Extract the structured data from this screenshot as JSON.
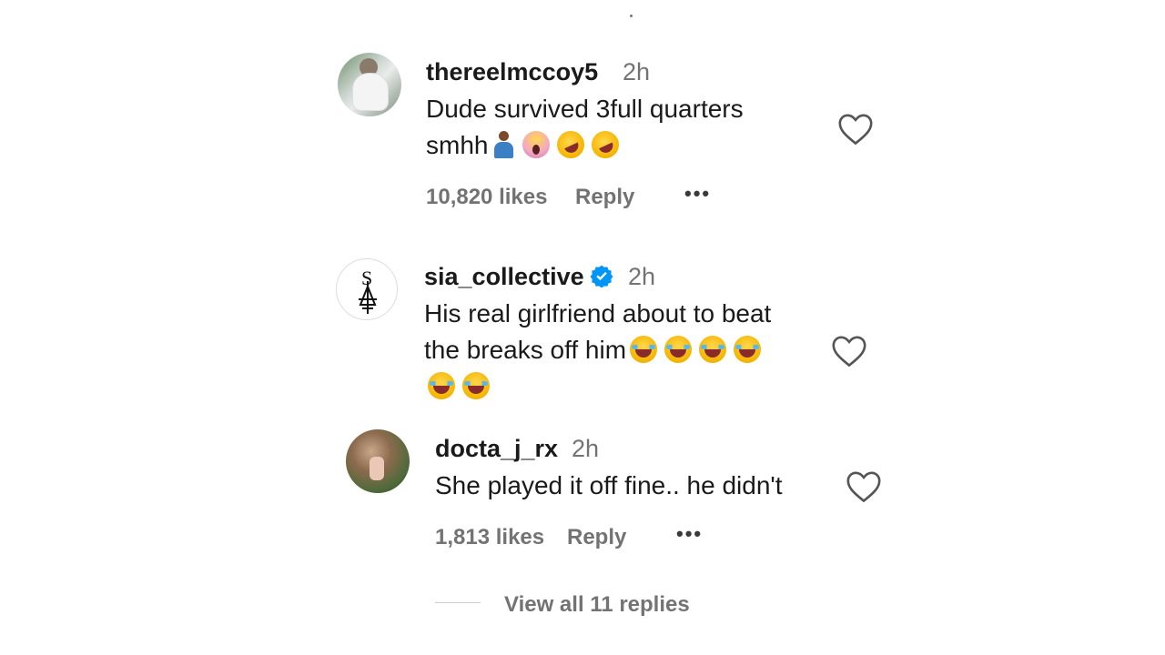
{
  "comments": [
    {
      "username": "thereelmccoy5",
      "time": "2h",
      "text_line1": "Dude survived 3full quarters",
      "text_line2": "smhh",
      "likes": "10,820 likes",
      "reply_label": "Reply",
      "more_label": "•••"
    },
    {
      "username": "sia_collective",
      "verified": true,
      "time": "2h",
      "text_line1": "His real girlfriend about to beat",
      "text_line2": "the breaks off him"
    },
    {
      "username": "docta_j_rx",
      "time": "2h",
      "text_line1": "She played it off fine.. he didn't",
      "likes": "1,813 likes",
      "reply_label": "Reply",
      "more_label": "•••"
    }
  ],
  "view_replies_label": "View all 11 replies",
  "colors": {
    "text": "#1a1a1a",
    "muted": "#737373",
    "verified_blue": "#0095f6"
  }
}
